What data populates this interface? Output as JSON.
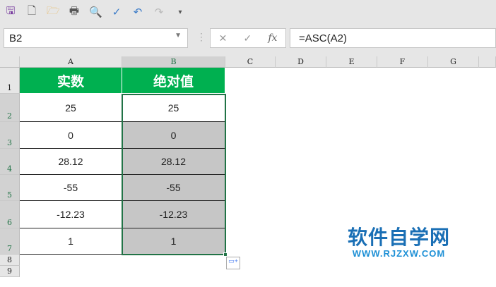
{
  "toolbar": {
    "icons": [
      "save-icon",
      "new-icon",
      "open-icon",
      "print-icon",
      "print-preview-icon",
      "spellcheck-icon",
      "undo-icon",
      "redo-icon",
      "customize-icon"
    ]
  },
  "formula_bar": {
    "name_box": "B2",
    "formula": "=ASC(A2)",
    "fx": "fx",
    "cancel": "✕",
    "confirm": "✓"
  },
  "columns": [
    "A",
    "B",
    "C",
    "D",
    "E",
    "F",
    "G"
  ],
  "rows": [
    "1",
    "2",
    "3",
    "4",
    "5",
    "6",
    "7",
    "8",
    "9"
  ],
  "table": {
    "headers": [
      "实数",
      "绝对值"
    ],
    "col_a": [
      "25",
      "0",
      "28.12",
      "-55",
      "-12.23",
      "1"
    ],
    "col_b": [
      "25",
      "0",
      "28.12",
      "-55",
      "-12.23",
      "1"
    ]
  },
  "watermark": {
    "title": "软件自学网",
    "url": "WWW.RJZXW.COM"
  },
  "colors": {
    "header_green": "#00b050",
    "selection": "#217346"
  }
}
